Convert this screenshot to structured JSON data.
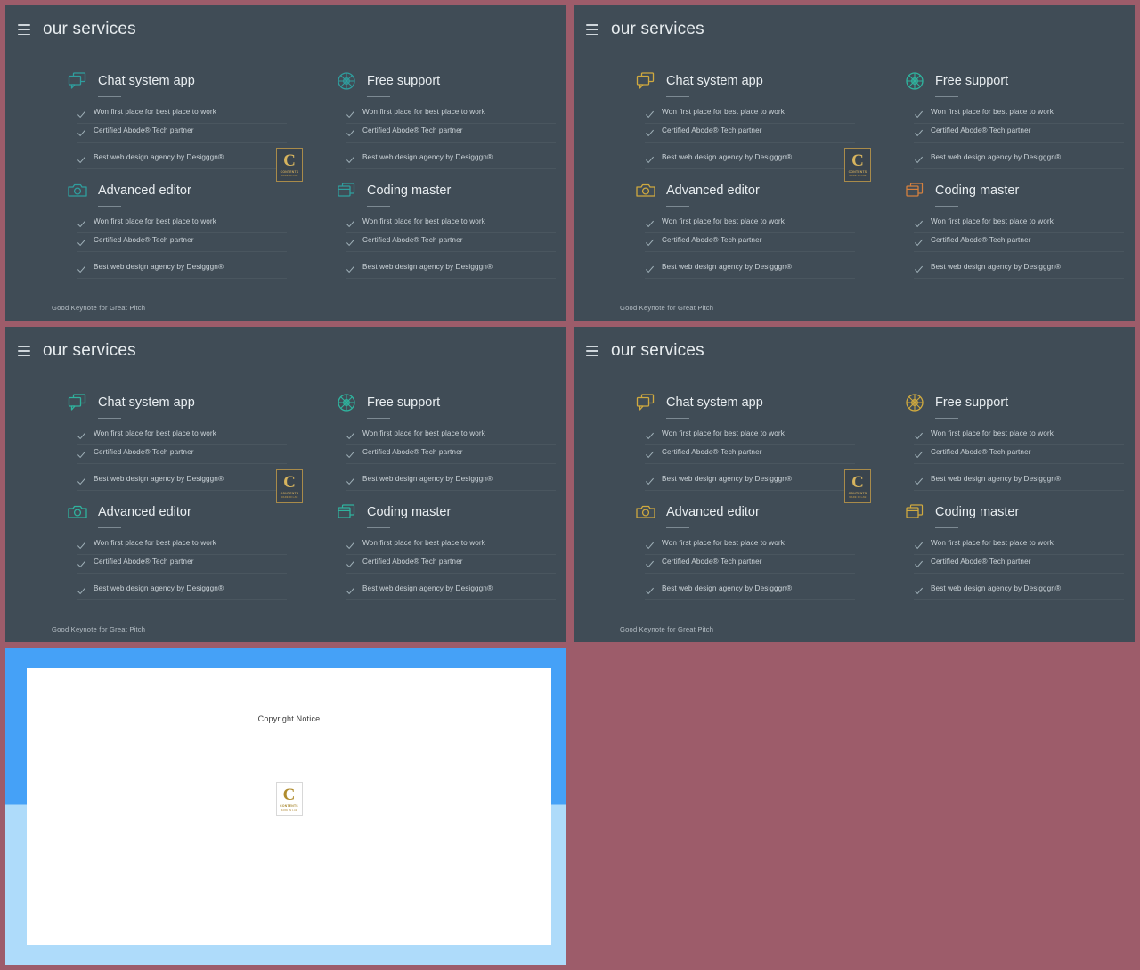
{
  "canvas": {
    "background_color": "#9d5c6a",
    "slide_background_color": "#404c56",
    "accent_color": "#2f9e9e",
    "badge_gold": "#d7b45e",
    "copyright_blue_top": "#45a1f7",
    "copyright_blue_bottom": "#aedbfa"
  },
  "slide": {
    "title": "our services",
    "menu_icon": "hamburger-icon",
    "footer": "Good Keynote for Great Pitch",
    "services": [
      {
        "name": "Chat system app",
        "icon": "chat-bubbles-icon",
        "items": [
          "Won first place for best place to work",
          "Certified Abode® Tech partner",
          "Best web design agency by Desigggn®"
        ]
      },
      {
        "name": "Free support",
        "icon": "ship-wheel-icon",
        "items": [
          "Won first place for best place to work",
          "Certified Abode® Tech partner",
          "Best web design agency by Desigggn®"
        ]
      },
      {
        "name": "Advanced editor",
        "icon": "camera-icon",
        "items": [
          "Won first place for best place to work",
          "Certified Abode® Tech partner",
          "Best web design agency by Desigggn®"
        ]
      },
      {
        "name": "Coding master",
        "icon": "stacked-windows-icon",
        "items": [
          "Won first place for best place to work",
          "Certified Abode® Tech partner",
          "Best web design agency by Desigggn®"
        ]
      }
    ],
    "badge": {
      "letter": "C",
      "label": "CONTENTS",
      "sublabel": "MADE IN LAB"
    }
  },
  "copyright_slide": {
    "title": "Copyright Notice",
    "badge": {
      "letter": "C",
      "label": "CONTENTS",
      "sublabel": "MADE IN LAB"
    }
  }
}
